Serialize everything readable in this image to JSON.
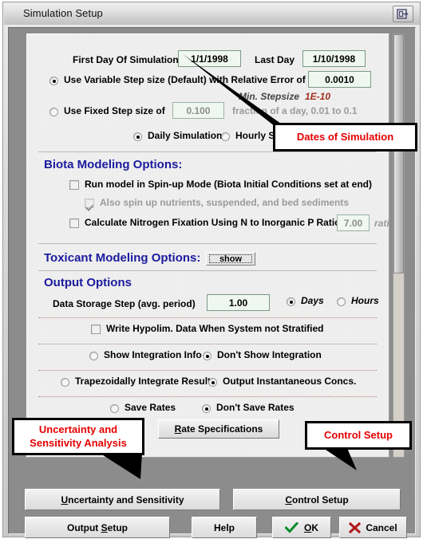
{
  "window": {
    "title": "Simulation Setup",
    "title_button_icon": "restore-window-icon"
  },
  "dates": {
    "first_day_label": "First Day Of Simulation",
    "first_day_value": "1/1/1998",
    "last_day_label": "Last Day",
    "last_day_value": "1/10/1998"
  },
  "step": {
    "variable_label": "Use Variable Step size (Default)  with Relative Error of",
    "variable_selected": true,
    "relative_error_value": "0.0010",
    "min_stepsize_label": "Min. Stepsize",
    "min_stepsize_value": "1E-10",
    "fixed_label": "Use Fixed Step size of",
    "fixed_selected": false,
    "fixed_value": "0.100",
    "fixed_hint": "fraction of a day, 0.01 to 0.1",
    "daily_label": "Daily Simulation",
    "daily_selected": true,
    "hourly_label": "Hourly Simulation",
    "hourly_selected": false
  },
  "biota": {
    "heading": "Biota Modeling Options:",
    "spinup_label": "Run model in Spin-up Mode (Biota Initial Conditions set at end)",
    "spinup_checked": false,
    "also_spinup_label": "Also spin up nutrients, suspended, and bed sediments",
    "also_spinup_checked": true,
    "nfix_label": "Calculate Nitrogen Fixation Using N to Inorganic P Ratio",
    "nfix_checked": false,
    "nfix_value": "7.00",
    "nfix_units": "ratio"
  },
  "toxicant": {
    "heading": "Toxicant Modeling Options:",
    "show_button": "show"
  },
  "output": {
    "heading": "Output Options",
    "storage_label": "Data Storage Step (avg. period)",
    "storage_value": "1.00",
    "days_label": "Days",
    "days_selected": true,
    "hours_label": "Hours",
    "hours_selected": false,
    "hypolim_label": "Write Hypolim. Data When System not Stratified",
    "hypolim_checked": false,
    "show_integration_label": "Show Integration Info",
    "show_integration_selected": false,
    "dont_show_integration_label": "Don't Show Integration",
    "dont_show_integration_selected": true,
    "trapezoidal_label": "Trapezoidally Integrate Results",
    "trapezoidal_selected": false,
    "instantaneous_label": "Output Instantaneous Concs.",
    "instantaneous_selected": true,
    "save_rates_label": "Save Rates",
    "save_rates_selected": false,
    "dont_save_rates_label": "Don't Save Rates",
    "dont_save_rates_selected": true,
    "rate_spec_button": "Rate Specifications",
    "rate_spec_accel": "R"
  },
  "footer": {
    "uncertainty_button": "Uncertainty and Sensitivity",
    "uncertainty_accel": "U",
    "control_setup_button": "Control Setup",
    "control_setup_accel": "C",
    "output_setup_button": "Output Setup",
    "output_setup_accel": "S",
    "help_button": "Help",
    "ok_button": "OK",
    "ok_accel": "O",
    "ok_icon": "check-icon",
    "cancel_button": "Cancel",
    "cancel_icon": "x-icon"
  },
  "annotations": {
    "dates": "Dates of Simulation",
    "uncertainty": "Uncertainty and\nSensitivity Analysis",
    "uncertainty_line1": "Uncertainty and",
    "uncertainty_line2": "Sensitivity Analysis",
    "control_setup": "Control Setup"
  },
  "colors": {
    "annotation_red": "#e60000",
    "section_blue": "#1b1b9e",
    "field_bg": "#eef7f0",
    "ok_green": "#0a8a2a",
    "cancel_red": "#b01818"
  }
}
